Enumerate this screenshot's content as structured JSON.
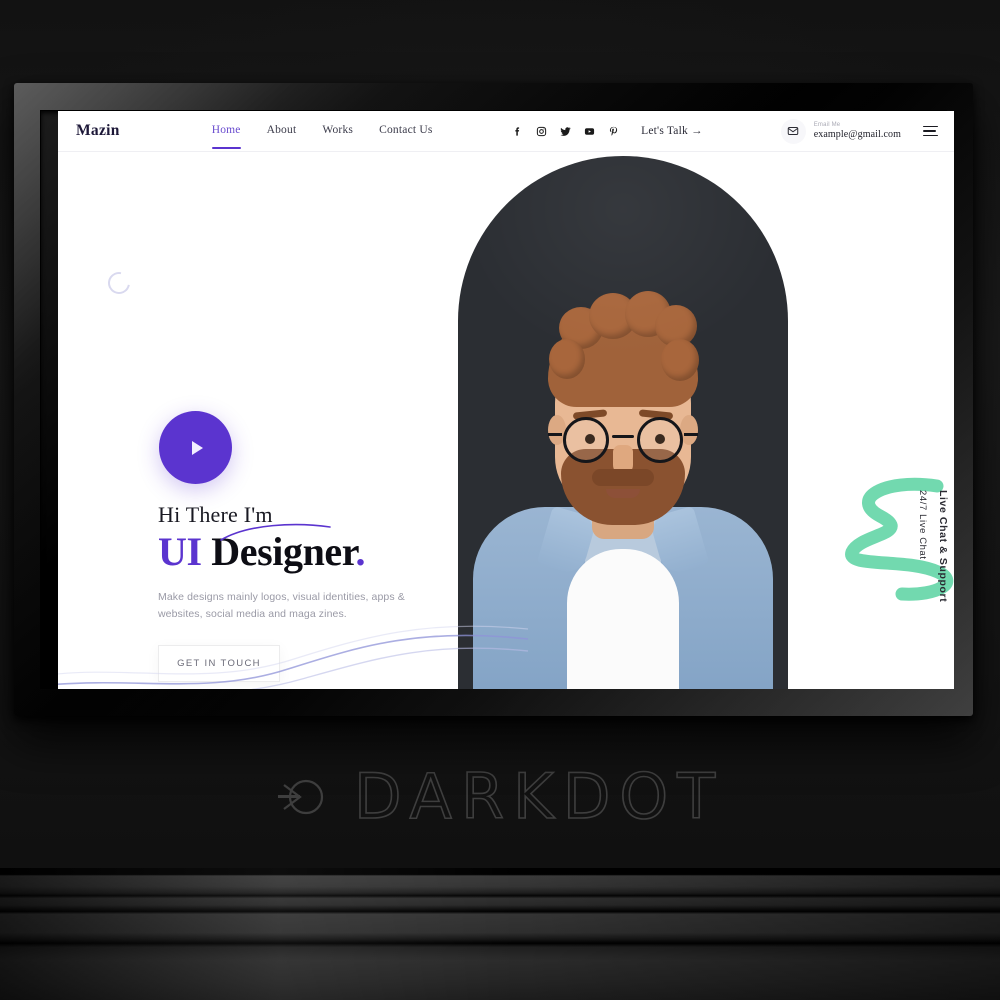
{
  "scene": {
    "watermark_text": "DARKDOT",
    "watermark_mark": "dc-logo-icon"
  },
  "site": {
    "brand": "Mazin",
    "nav": [
      {
        "label": "Home",
        "active": true
      },
      {
        "label": "About",
        "active": false
      },
      {
        "label": "Works",
        "active": false
      },
      {
        "label": "Contact Us",
        "active": false
      }
    ],
    "socials": [
      {
        "name": "facebook-icon"
      },
      {
        "name": "instagram-icon"
      },
      {
        "name": "twitter-icon"
      },
      {
        "name": "youtube-icon"
      },
      {
        "name": "pinterest-icon"
      }
    ],
    "lets_talk": "Let's Talk →",
    "email": {
      "label": "Email Me",
      "value": "example@gmail.com"
    }
  },
  "hero": {
    "eyebrow": "Hi There I'm",
    "title_accent": "UI",
    "title_rest": "Designer",
    "title_dot": ".",
    "subtitle": "Make designs mainly logos, visual identities, apps & websites, social media and maga zines.",
    "cta_label": "GET IN TOUCH",
    "play_label": "play-video"
  },
  "side_panel": {
    "line_one": "24/7 Live Chat",
    "line_two": "Live Chat & Support"
  },
  "colors": {
    "accent_purple": "#5b34cf",
    "accent_green": "#72d9af",
    "arch_dark": "#2b2e33",
    "text_dark": "#0d0d14",
    "text_muted": "#9a9aa6",
    "frame_black": "#0b0b0b"
  }
}
